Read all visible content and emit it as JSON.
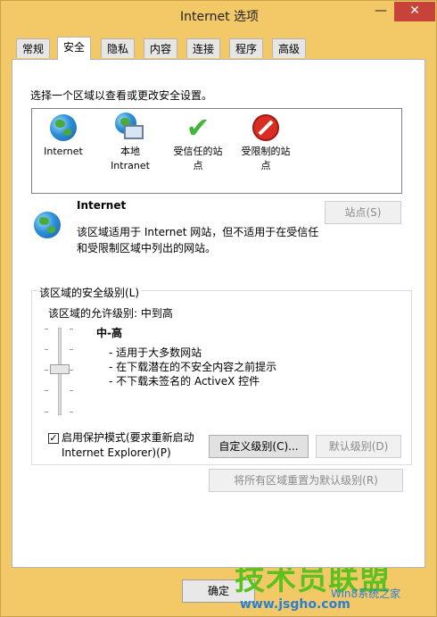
{
  "window": {
    "title": "Internet 选项",
    "minimize": "—",
    "close": "✕"
  },
  "tabs": [
    "常规",
    "安全",
    "隐私",
    "内容",
    "连接",
    "程序",
    "高级"
  ],
  "security": {
    "prompt": "选择一个区域以查看或更改安全设置。",
    "zones": [
      {
        "label": "Internet",
        "icon": "globe-icon"
      },
      {
        "label": "本地\nIntranet",
        "icon": "local-intranet-icon"
      },
      {
        "label": "受信任的站\n点",
        "icon": "trusted-sites-icon"
      },
      {
        "label": "受限制的站\n点",
        "icon": "restricted-sites-icon"
      }
    ],
    "selected_zone": {
      "name": "Internet",
      "description": "该区域适用于 Internet 网站，但不适用于在受信任\n和受限制区域中列出的网站。",
      "sites_button": "站点(S)"
    },
    "level_group": {
      "title": "该区域的安全级别(L)",
      "allowed": "该区域的允许级别: 中到高",
      "level_name": "中-高",
      "bullets": [
        "- 适用于大多数网站",
        "- 在下载潜在的不安全内容之前提示",
        "- 不下载未签名的 ActiveX 控件"
      ],
      "slider_level": "中-高",
      "protected_mode_label": "启用保护模式(要求重新启动\nInternet Explorer)(P)",
      "protected_mode_checked": true,
      "custom_button": "自定义级别(C)...",
      "default_button": "默认级别(D)"
    },
    "reset_all_button": "将所有区域重置为默认级别(R)"
  },
  "footer": {
    "ok_button": "确定"
  },
  "watermark": {
    "brand": "技术员联盟",
    "url": "www.jsgho.com",
    "sub": "Win8系统之家"
  }
}
